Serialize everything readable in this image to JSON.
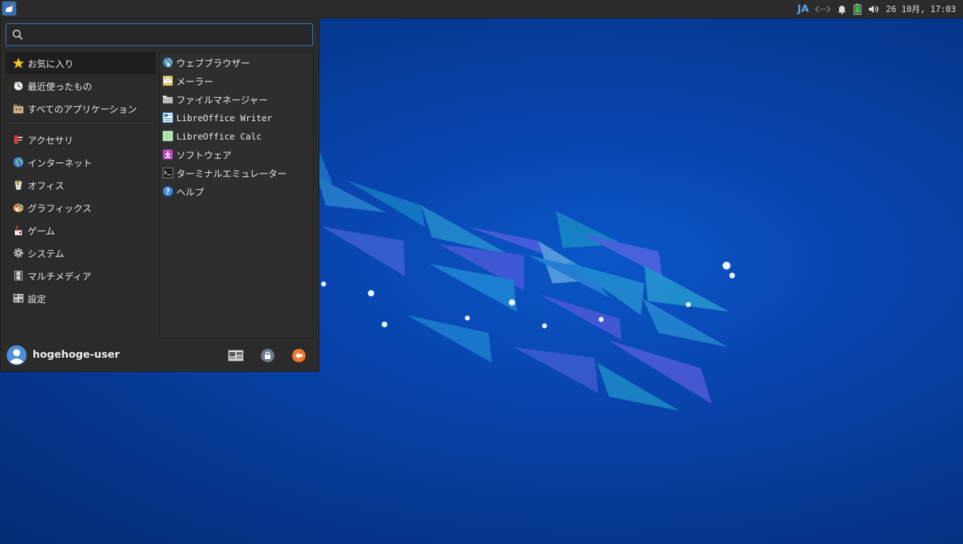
{
  "panel": {
    "lang": "JA",
    "clock": "26 10月, 17:03"
  },
  "search": {
    "placeholder": "",
    "value": ""
  },
  "categories": [
    {
      "label": "お気に入り",
      "icon": "star-icon"
    },
    {
      "label": "最近使ったもの",
      "icon": "recent-icon"
    },
    {
      "label": "すべてのアプリケーション",
      "icon": "all-apps-icon"
    },
    {
      "label": "アクセサリ",
      "icon": "accessories-icon"
    },
    {
      "label": "インターネット",
      "icon": "internet-icon"
    },
    {
      "label": "オフィス",
      "icon": "office-icon"
    },
    {
      "label": "グラフィックス",
      "icon": "graphics-icon"
    },
    {
      "label": "ゲーム",
      "icon": "games-icon"
    },
    {
      "label": "システム",
      "icon": "system-icon"
    },
    {
      "label": "マルチメディア",
      "icon": "multimedia-icon"
    },
    {
      "label": "設定",
      "icon": "settings-icon"
    }
  ],
  "apps": [
    {
      "label": "ウェブブラウザー",
      "icon": "web-browser-icon"
    },
    {
      "label": "メーラー",
      "icon": "mail-icon"
    },
    {
      "label": "ファイルマネージャー",
      "icon": "folder-icon"
    },
    {
      "label": "LibreOffice Writer",
      "icon": "writer-icon"
    },
    {
      "label": "LibreOffice Calc",
      "icon": "calc-icon"
    },
    {
      "label": "ソフトウェア",
      "icon": "software-icon"
    },
    {
      "label": "ターミナルエミュレーター",
      "icon": "terminal-icon"
    },
    {
      "label": "ヘルプ",
      "icon": "help-icon"
    }
  ],
  "footer": {
    "username": "hogehoge-user"
  },
  "colors": {
    "accent": "#3d7ac8",
    "menu_bg": "#2b2b2b",
    "logout": "#f0782a"
  }
}
